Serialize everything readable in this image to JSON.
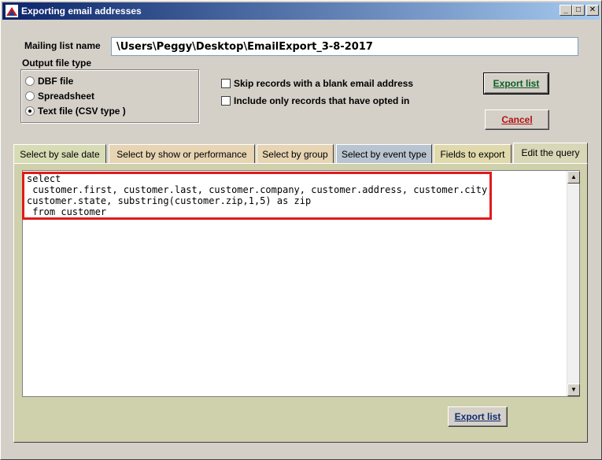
{
  "window": {
    "title": "Exporting email addresses",
    "controls": {
      "minimize": "_",
      "maximize": "□",
      "close": "✕"
    }
  },
  "mailing_list": {
    "label": "Mailing list name",
    "value": "\\Users\\Peggy\\Desktop\\EmailExport_3-8-2017"
  },
  "output_type": {
    "label": "Output file type",
    "options": [
      {
        "label": "DBF file",
        "selected": false
      },
      {
        "label": "Spreadsheet",
        "selected": false
      },
      {
        "label": "Text file (CSV type )",
        "selected": true
      }
    ]
  },
  "options": {
    "skip_blank": "Skip records with a blank email address",
    "opted_in": "Include only records that have opted in"
  },
  "buttons": {
    "export_top": "Export list",
    "cancel": "Cancel",
    "export_bottom": "Export list"
  },
  "tabs": [
    {
      "label": "Select by sale date"
    },
    {
      "label": "Select by show or performance"
    },
    {
      "label": "Select by group"
    },
    {
      "label": "Select by event type"
    },
    {
      "label": "Fields to export"
    },
    {
      "label": "Edit the query",
      "active": true
    }
  ],
  "query": {
    "text": "select\n customer.first, customer.last, customer.company, customer.address, customer.city,\ncustomer.state, substring(customer.zip,1,5) as zip\n from customer"
  },
  "colors": {
    "highlight": "#e01b1b",
    "title_bar": "#0a246a"
  }
}
